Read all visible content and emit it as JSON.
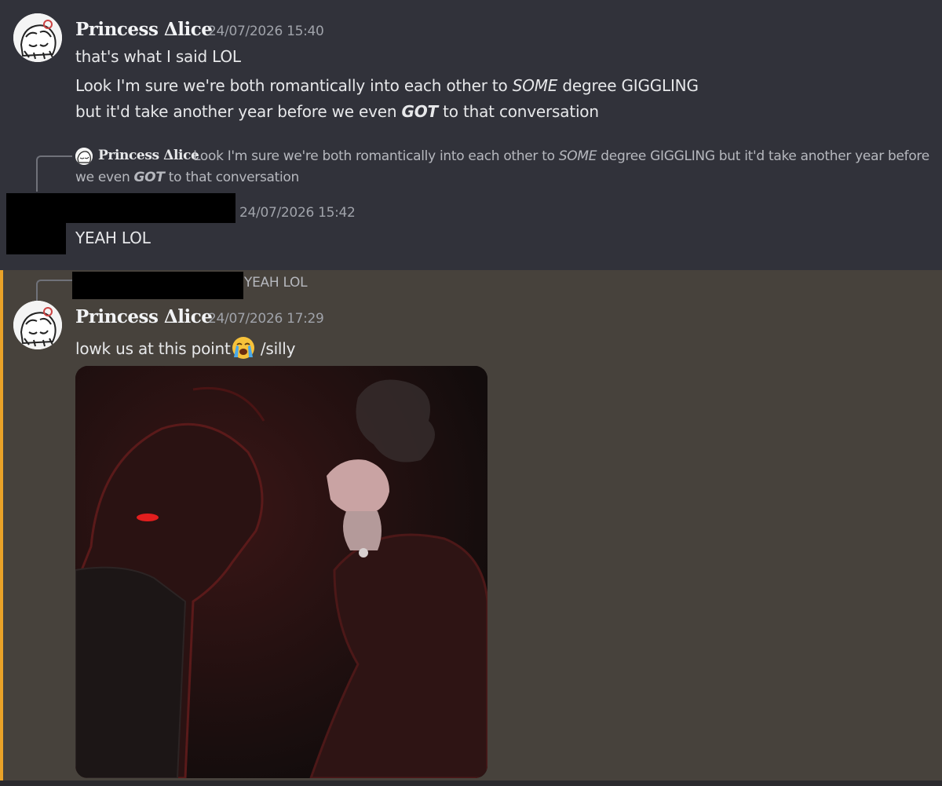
{
  "messages": [
    {
      "author": "Princess Δlice",
      "timestamp": "24/07/2026 15:40",
      "lines": [
        "that's what I said LOL"
      ],
      "line2": {
        "part1": "Look I'm sure we're both romantically into each other to ",
        "em": "SOME",
        "part2": " degree GIGGLING"
      },
      "line3": {
        "part1": "but it'd take another year before we even ",
        "strong": "GOT",
        "part2": " to that conversation"
      }
    },
    {
      "reply": {
        "author": "Princess Δlice",
        "text1": "Look I'm sure we're both romantically into each other to ",
        "em": "SOME",
        "text2": " degree GIGGLING but it'd take another year before",
        "text3": "we even ",
        "strong": "GOT",
        "text4": " to that conversation"
      },
      "author_redacted": true,
      "timestamp": "24/07/2026 15:42",
      "text": "YEAH LOL"
    },
    {
      "reply": {
        "author_redacted": true,
        "text": "YEAH LOL"
      },
      "author": "Princess Δlice",
      "timestamp": "24/07/2026 17:29",
      "text_before_emoji": "lowk us at this point",
      "emoji": "loudly-crying-face-icon",
      "text_after_emoji": " /silly",
      "attachment": "image-attachment"
    }
  ],
  "colors": {
    "background": "#31323a",
    "mention_background": "#47423c",
    "mention_bar": "#e9a228"
  }
}
